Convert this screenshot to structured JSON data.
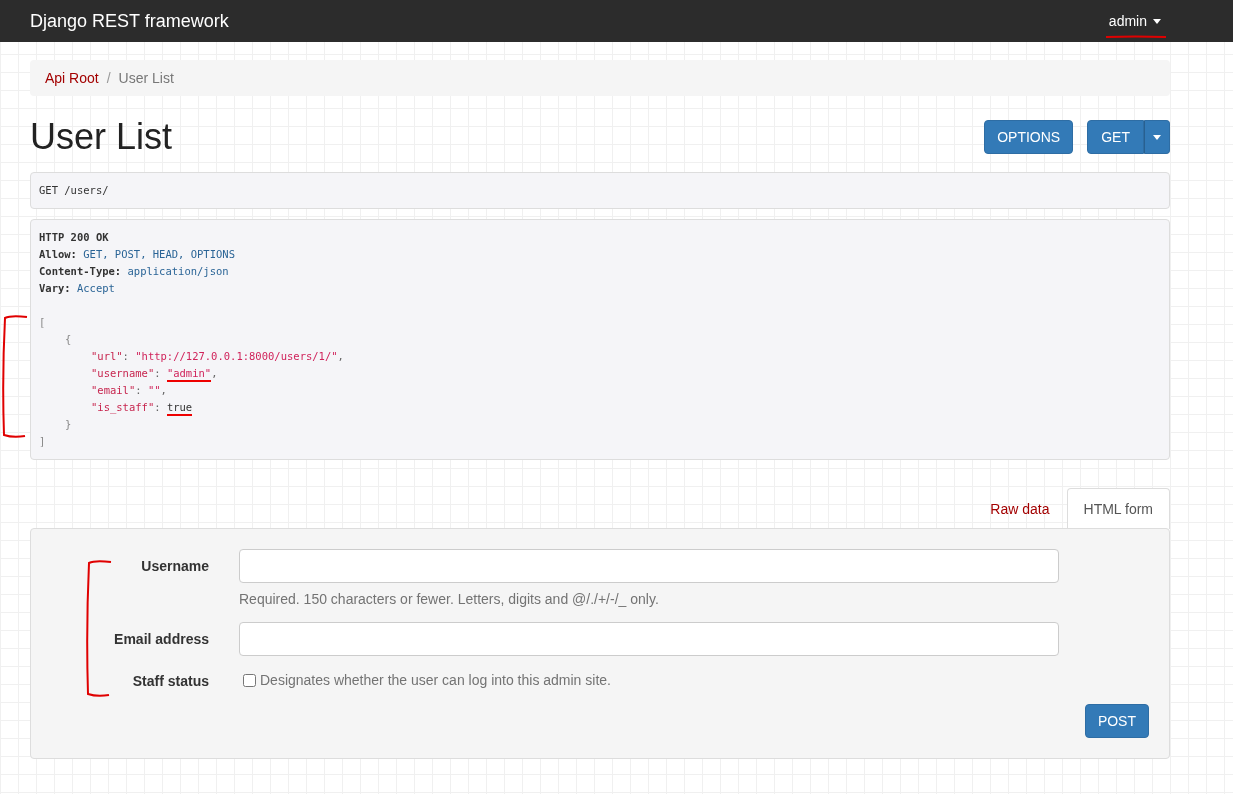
{
  "navbar": {
    "brand": "Django REST framework",
    "user": {
      "label": "admin",
      "underlined": true
    }
  },
  "breadcrumb_separator": "/",
  "breadcrumb": [
    {
      "label": "Api Root",
      "selected": false
    },
    {
      "label": "User List",
      "selected": true
    }
  ],
  "title": "User List",
  "actions": [
    {
      "label": "OPTIONS",
      "kind": "button"
    },
    {
      "label": "GET",
      "kind": "split"
    }
  ],
  "request": "GET /users/",
  "response": {
    "status": "HTTP 200 OK",
    "headers": [
      {
        "name": "Allow:",
        "value": "GET, POST, HEAD, OPTIONS"
      },
      {
        "name": "Content-Type:",
        "value": "application/json"
      },
      {
        "name": "Vary:",
        "value": "Accept"
      }
    ],
    "bracketed": true,
    "body": {
      "open": "[",
      "close": "]",
      "children": [
        {
          "open": "{",
          "close": "}",
          "children": [
            [
              {
                "text": "\"url\"",
                "kind": "key"
              },
              {
                "text": ": ",
                "kind": "punct"
              },
              {
                "text": "\"http://127.0.0.1:8000/users/1/\"",
                "kind": "string"
              },
              {
                "text": ",",
                "kind": "punct"
              }
            ],
            [
              {
                "text": "\"username\"",
                "kind": "key"
              },
              {
                "text": ": ",
                "kind": "punct"
              },
              {
                "text": "\"admin\"",
                "kind": "string",
                "underlined": true
              },
              {
                "text": ",",
                "kind": "punct"
              }
            ],
            [
              {
                "text": "\"email\"",
                "kind": "key"
              },
              {
                "text": ": ",
                "kind": "punct"
              },
              {
                "text": "\"\"",
                "kind": "string"
              },
              {
                "text": ",",
                "kind": "punct"
              }
            ],
            [
              {
                "text": "\"is_staff\"",
                "kind": "key"
              },
              {
                "text": ": ",
                "kind": "punct"
              },
              {
                "text": "true",
                "kind": "literal",
                "underlined": true
              }
            ]
          ]
        }
      ]
    }
  },
  "form_tabs": [
    {
      "label": "Raw data",
      "selected": false
    },
    {
      "label": "HTML form",
      "selected": true
    }
  ],
  "form": {
    "bracketed": true,
    "fields": [
      {
        "kind": "text",
        "label": "Username",
        "help": "Required. 150 characters or fewer. Letters, digits and @/./+/-/_ only."
      },
      {
        "kind": "text",
        "label": "Email address"
      },
      {
        "kind": "checkbox",
        "label": "Staff status",
        "checked": false,
        "help": "Designates whether the user can log into this admin site."
      }
    ],
    "submit": "POST"
  }
}
